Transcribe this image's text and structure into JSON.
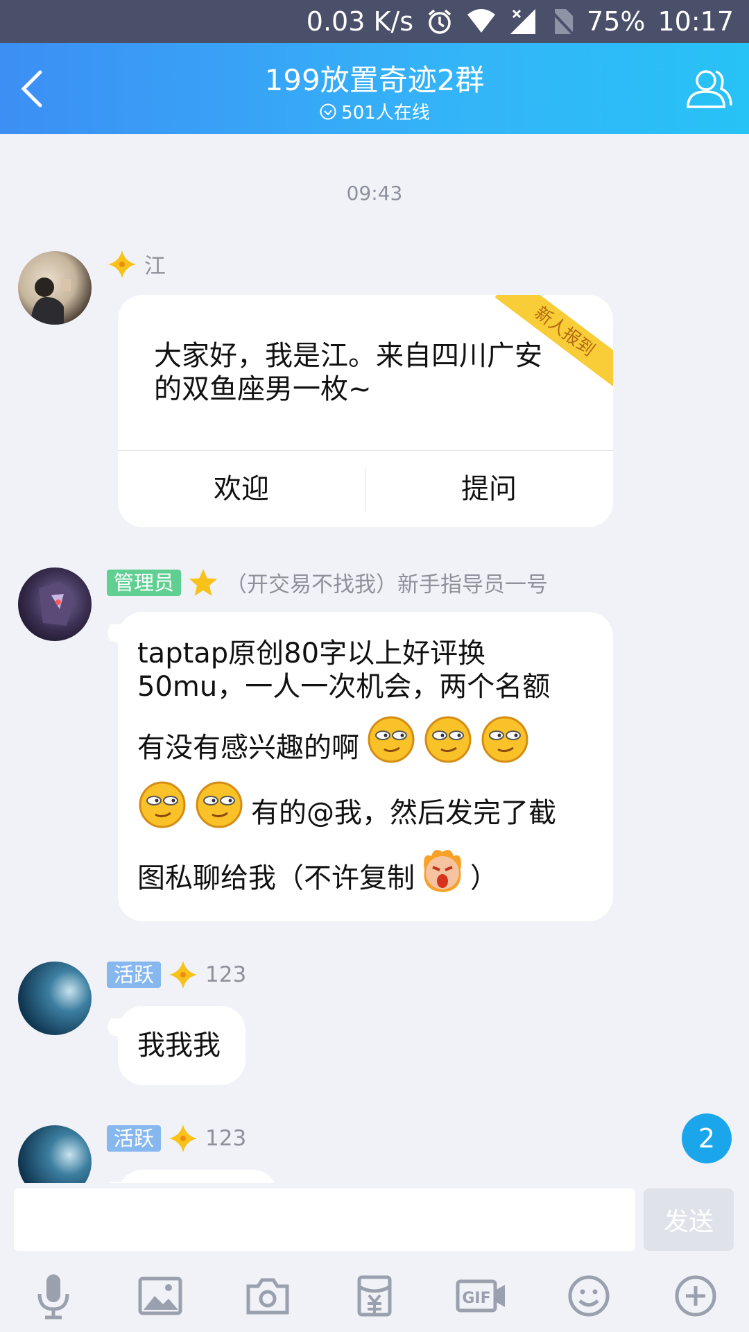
{
  "status_bar": {
    "speed": "0.03 K/s",
    "battery": "75%",
    "time": "10:17"
  },
  "header": {
    "title": "199放置奇迹2群",
    "online": "501人在线"
  },
  "chat": {
    "time": "09:43",
    "messages": [
      {
        "name": "江",
        "card_text": "大家好，我是江。来自四川广安的双鱼座男一枚~",
        "ribbon": "新人报到",
        "btn_welcome": "欢迎",
        "btn_question": "提问"
      },
      {
        "tag": "管理员",
        "name": "（开交易不找我）新手指导员一号",
        "text1": "taptap原创80字以上好评换50mu，一人一次机会，两个名额",
        "text2": "有没有感兴趣的啊",
        "text3": "有的@我，然后发完了截",
        "text4": "图私聊给我（不许复制",
        "text5": "）"
      },
      {
        "tag": "活跃",
        "name": "123",
        "text": "我我我"
      },
      {
        "tag": "活跃",
        "name": "123"
      }
    ],
    "unread_count": "2"
  },
  "input": {
    "placeholder": "",
    "send_label": "发送"
  },
  "colors": {
    "header_start": "#3c8ff4",
    "header_end": "#27c2f6",
    "admin_tag": "#5fcf92",
    "active_tag": "#86b7ef",
    "badge": "#1ba6ec"
  },
  "toolbar_icons": [
    "microphone-icon",
    "image-icon",
    "camera-icon",
    "red-packet-icon",
    "gif-icon",
    "emoji-icon",
    "plus-icon"
  ]
}
